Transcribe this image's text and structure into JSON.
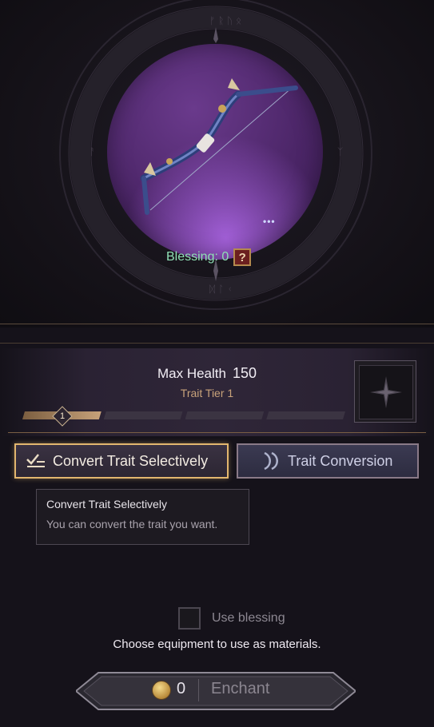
{
  "item": {
    "icon": "bow-icon",
    "more_icon": "ellipsis-icon"
  },
  "blessing": {
    "label": "Blessing: 0",
    "help_icon": "?"
  },
  "trait": {
    "name": "Max Health",
    "value": "150",
    "tier_label": "Trait Tier 1",
    "tier": "1",
    "progress_segments": 4,
    "progress_filled": 1
  },
  "buttons": {
    "convert_selective": "Convert Trait Selectively",
    "trait_conversion": "Trait Conversion"
  },
  "tooltip": {
    "title": "Convert Trait Selectively",
    "description": "You can convert the trait you want."
  },
  "use_blessing": {
    "label": "Use blessing",
    "checked": false
  },
  "instructions": "Choose equipment to use as materials.",
  "enchant": {
    "cost": "0",
    "label": "Enchant"
  },
  "colors": {
    "accent_gold": "#e2b66e",
    "blessing_green": "#8fe0b5",
    "orb_purple": "#4c2668"
  }
}
